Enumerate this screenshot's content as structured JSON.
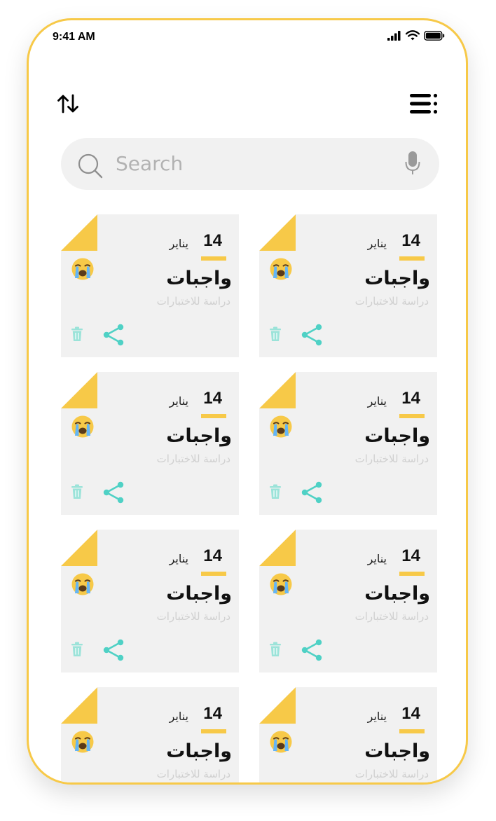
{
  "status_bar": {
    "time": "9:41 AM"
  },
  "search": {
    "placeholder": "Search",
    "value": ""
  },
  "colors": {
    "accent": "#f7c948",
    "card_bg": "#f1f1f1",
    "share": "#4fd1c5",
    "trash": "#9be3d9"
  },
  "notes": [
    {
      "day": "14",
      "month": "يناير",
      "title": "واجبات",
      "subtitle": "دراسة للاختبارات",
      "emoji": "loudly-crying-face"
    },
    {
      "day": "14",
      "month": "يناير",
      "title": "واجبات",
      "subtitle": "دراسة للاختبارات",
      "emoji": "loudly-crying-face"
    },
    {
      "day": "14",
      "month": "يناير",
      "title": "واجبات",
      "subtitle": "دراسة للاختبارات",
      "emoji": "loudly-crying-face"
    },
    {
      "day": "14",
      "month": "يناير",
      "title": "واجبات",
      "subtitle": "دراسة للاختبارات",
      "emoji": "loudly-crying-face"
    },
    {
      "day": "14",
      "month": "يناير",
      "title": "واجبات",
      "subtitle": "دراسة للاختبارات",
      "emoji": "loudly-crying-face"
    },
    {
      "day": "14",
      "month": "يناير",
      "title": "واجبات",
      "subtitle": "دراسة للاختبارات",
      "emoji": "loudly-crying-face"
    },
    {
      "day": "14",
      "month": "يناير",
      "title": "واجبات",
      "subtitle": "دراسة للاختبارات",
      "emoji": "loudly-crying-face"
    },
    {
      "day": "14",
      "month": "يناير",
      "title": "واجبات",
      "subtitle": "دراسة للاختبارات",
      "emoji": "loudly-crying-face"
    }
  ]
}
